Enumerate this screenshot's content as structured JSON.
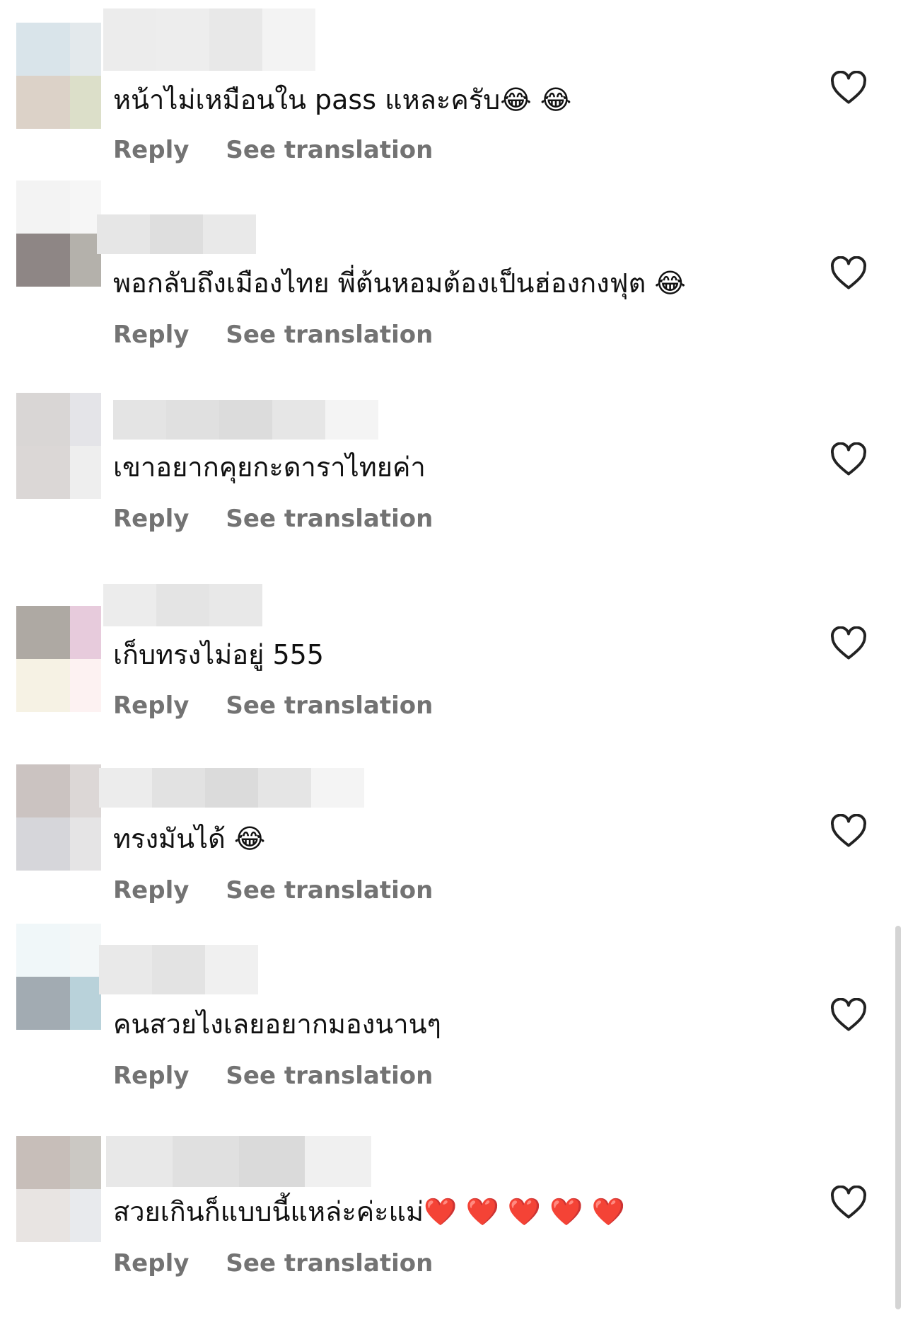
{
  "comments": [
    {
      "text": "หน้าไม่เหมือนใน pass แหละครับ😂 😂",
      "reply": "Reply",
      "translate": "See translation",
      "heart_icon": "heart-outline-icon",
      "avatar": [
        "#d9e4ea",
        "#e3e9ec",
        "#dcd2c8",
        "#dcdfc9"
      ],
      "name": [
        "#ececec",
        "#ededed",
        "#e8e8e8",
        "#f3f3f3"
      ]
    },
    {
      "text": "พอกลับถึงเมืองไทย  พี่ต้นหอมต้องเป็นฮ่องกงฟุต 😂",
      "reply": "Reply",
      "translate": "See translation",
      "heart_icon": "heart-outline-icon",
      "avatar": [
        "#f3f3f3",
        "#f6f6f6",
        "#8e8685",
        "#b4b1ab"
      ],
      "name": [
        "#e6e6e6",
        "#dedede",
        "#e9e9e9"
      ]
    },
    {
      "text": "เขาอยากคุยกะดาราไทยค่า",
      "reply": "Reply",
      "translate": "See translation",
      "heart_icon": "heart-outline-icon",
      "avatar": [
        "#d9d6d5",
        "#e4e4e8",
        "#dbd7d6",
        "#eeeeee"
      ],
      "name": [
        "#e4e4e4",
        "#e0e0e0",
        "#dcdcdc",
        "#e6e6e6",
        "#f4f4f4"
      ]
    },
    {
      "text": "เก็บทรงไม่อยู่ 555",
      "reply": "Reply",
      "translate": "See translation",
      "heart_icon": "heart-outline-icon",
      "avatar": [
        "#aea9a3",
        "#e7cbdc",
        "#f6f2e4",
        "#fdf2f2"
      ],
      "name": [
        "#ececec",
        "#e4e4e4",
        "#e8e8e8"
      ]
    },
    {
      "text": "ทรงมันได้ 😂",
      "reply": "Reply",
      "translate": "See translation",
      "heart_icon": "heart-outline-icon",
      "avatar": [
        "#cbc3c1",
        "#dcd7d6",
        "#d6d6da",
        "#e5e4e5"
      ],
      "name": [
        "#ececec",
        "#e2e2e2",
        "#dbdbdb",
        "#e5e5e5",
        "#f4f4f4"
      ]
    },
    {
      "text": "คนสวยไงเลยอยากมองนานๆ",
      "reply": "Reply",
      "translate": "See translation",
      "heart_icon": "heart-outline-icon",
      "avatar": [
        "#f0f7f9",
        "#f3f7f8",
        "#a2abb2",
        "#b9d2da"
      ],
      "name": [
        "#e9e9e9",
        "#e3e3e3",
        "#f0f0f0"
      ]
    },
    {
      "text": "สวยเกินก็แบบนี้แหล่ะค่ะแม่❤️ ❤️ ❤️ ❤️ ❤️",
      "reply": "Reply",
      "translate": "See translation",
      "heart_icon": "heart-outline-icon",
      "avatar": [
        "#c7beb9",
        "#cbc8c3",
        "#e8e4e2",
        "#e8eaed"
      ],
      "name": [
        "#e8e8e8",
        "#e0e0e0",
        "#dadada",
        "#f0f0f0"
      ]
    }
  ]
}
